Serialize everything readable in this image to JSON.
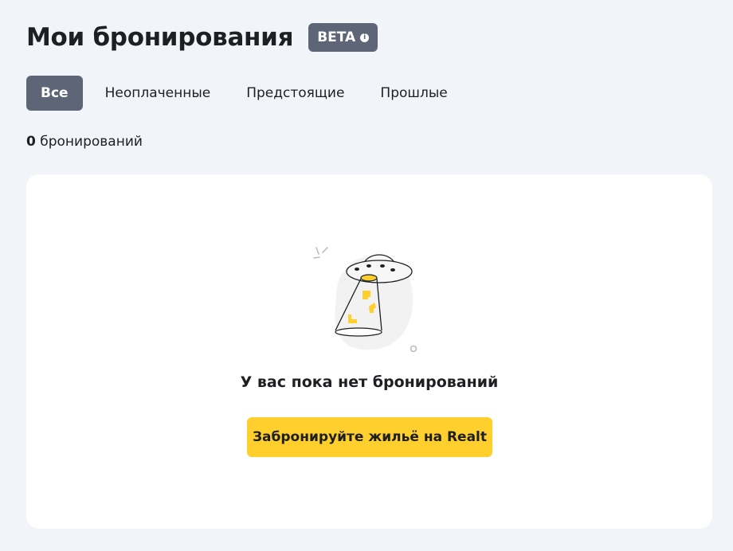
{
  "header": {
    "title": "Мои бронирования",
    "badge": "BETA",
    "badge_info_glyph": "i"
  },
  "tabs": [
    {
      "label": "Все",
      "active": true
    },
    {
      "label": "Неоплаченные",
      "active": false
    },
    {
      "label": "Предстоящие",
      "active": false
    },
    {
      "label": "Прошлые",
      "active": false
    }
  ],
  "summary": {
    "count": "0",
    "count_label": "бронирований"
  },
  "empty_state": {
    "illustration": "ufo-icon",
    "message": "У вас пока нет бронирований",
    "cta_label": "Забронируйте жильё на Realt"
  },
  "colors": {
    "background": "#f1f4f8",
    "active_tab": "#5d6577",
    "cta": "#ffd02d",
    "card": "#ffffff"
  }
}
